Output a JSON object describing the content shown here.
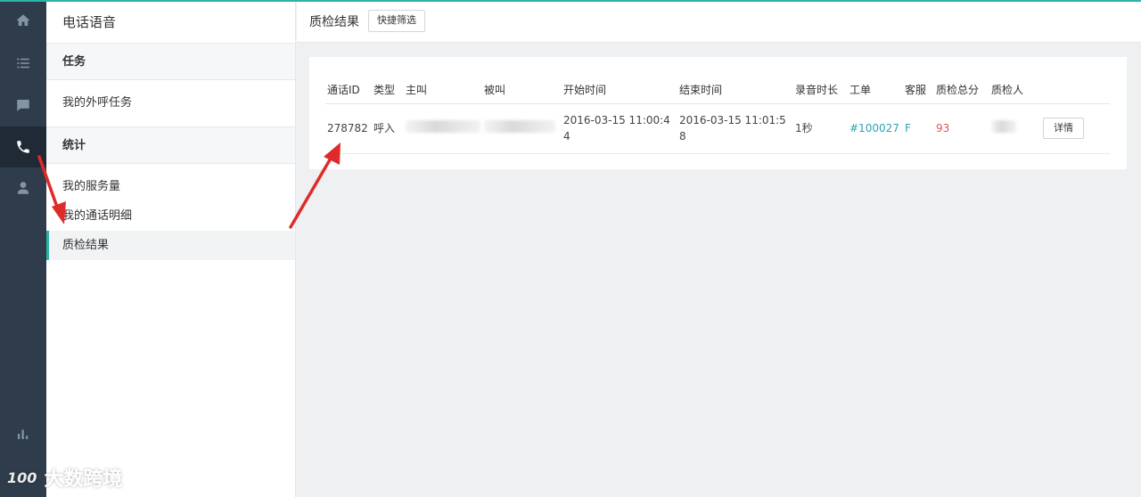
{
  "rail": {
    "items": [
      {
        "name": "home-icon"
      },
      {
        "name": "list-icon"
      },
      {
        "name": "chat-icon"
      },
      {
        "name": "phone-icon",
        "active": true
      },
      {
        "name": "user-icon"
      },
      {
        "name": "bar-chart-icon"
      }
    ]
  },
  "sidebar": {
    "title": "电话语音",
    "section_task": "任务",
    "task_link": "我的外呼任务",
    "section_stats": "统计",
    "links": [
      "我的服务量",
      "我的通话明细",
      "质检结果"
    ],
    "active": "质检结果"
  },
  "main": {
    "title": "质检结果",
    "filter_button": "快捷筛选"
  },
  "table": {
    "headers": [
      "通话ID",
      "类型",
      "主叫",
      "被叫",
      "开始时间",
      "结束时间",
      "录音时长",
      "工单",
      "客服",
      "质检总分",
      "质检人"
    ],
    "row": {
      "call_id": "278782",
      "type": "呼入",
      "caller": "",
      "callee": "",
      "start_time": "2016-03-15 11:00:44",
      "end_time": "2016-03-15 11:01:58",
      "duration": "1秒",
      "ticket": "#100027",
      "agent": "F",
      "score": "93",
      "inspector": "",
      "detail_button": "详情"
    }
  },
  "watermark": {
    "logo": "100",
    "text": "大数跨境"
  },
  "colors": {
    "accent": "#2cb5a5",
    "rail_bg": "#2f3c4b",
    "link": "#2aa5b5",
    "score": "#e0545f",
    "arrow": "#e02a2a"
  }
}
